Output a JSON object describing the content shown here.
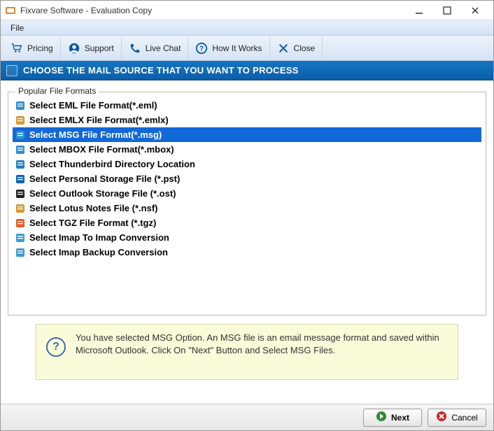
{
  "window": {
    "title": "Fixvare Software - Evaluation Copy"
  },
  "menubar": {
    "file": "File"
  },
  "toolbar": {
    "pricing": "Pricing",
    "support": "Support",
    "livechat": "Live Chat",
    "howitworks": "How It Works",
    "close": "Close"
  },
  "banner": {
    "title": "CHOOSE THE MAIL SOURCE THAT YOU WANT TO PROCESS"
  },
  "fieldset": {
    "legend": "Popular File Formats"
  },
  "formats": [
    {
      "label": "Select EML File Format(*.eml)",
      "selected": false
    },
    {
      "label": "Select EMLX File Format(*.emlx)",
      "selected": false
    },
    {
      "label": "Select MSG File Format(*.msg)",
      "selected": true
    },
    {
      "label": "Select MBOX File Format(*.mbox)",
      "selected": false
    },
    {
      "label": "Select Thunderbird Directory Location",
      "selected": false
    },
    {
      "label": "Select Personal Storage File (*.pst)",
      "selected": false
    },
    {
      "label": "Select Outlook Storage File (*.ost)",
      "selected": false
    },
    {
      "label": "Select Lotus Notes File (*.nsf)",
      "selected": false
    },
    {
      "label": "Select TGZ File Format (*.tgz)",
      "selected": false
    },
    {
      "label": "Select Imap To Imap Conversion",
      "selected": false
    },
    {
      "label": "Select Imap Backup Conversion",
      "selected": false
    }
  ],
  "info": {
    "text": "You have selected MSG Option. An MSG file is an email message format and saved within Microsoft Outlook. Click On \"Next\" Button and Select MSG Files."
  },
  "footer": {
    "next": "Next",
    "cancel": "Cancel"
  },
  "icon_colors": {
    "eml": "#2f8fd1",
    "emlx": "#d79a2b",
    "msg": "#2f8fd1",
    "mbox": "#2f8fd1",
    "thunderbird": "#1c82c4",
    "pst": "#0a63b6",
    "ost": "#222222",
    "nsf": "#d79a2b",
    "tgz": "#e85a2d",
    "imap1": "#3a9cd6",
    "imap2": "#3a9cd6"
  }
}
